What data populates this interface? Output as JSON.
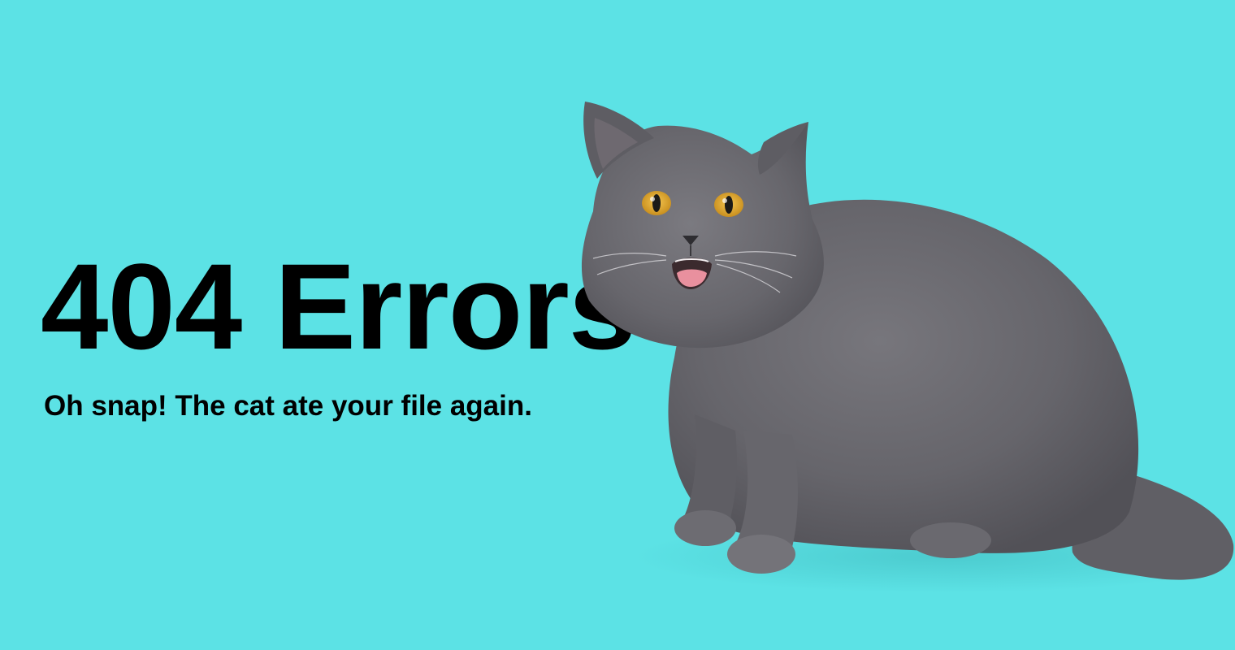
{
  "page": {
    "background_color": "#5ce2e5",
    "heading": "404 Errors",
    "message": "Oh snap! The cat ate your file again."
  },
  "illustration": {
    "subject": "grey cat",
    "eye_color": "#e3a928",
    "fur_color": "#6b6a70"
  }
}
